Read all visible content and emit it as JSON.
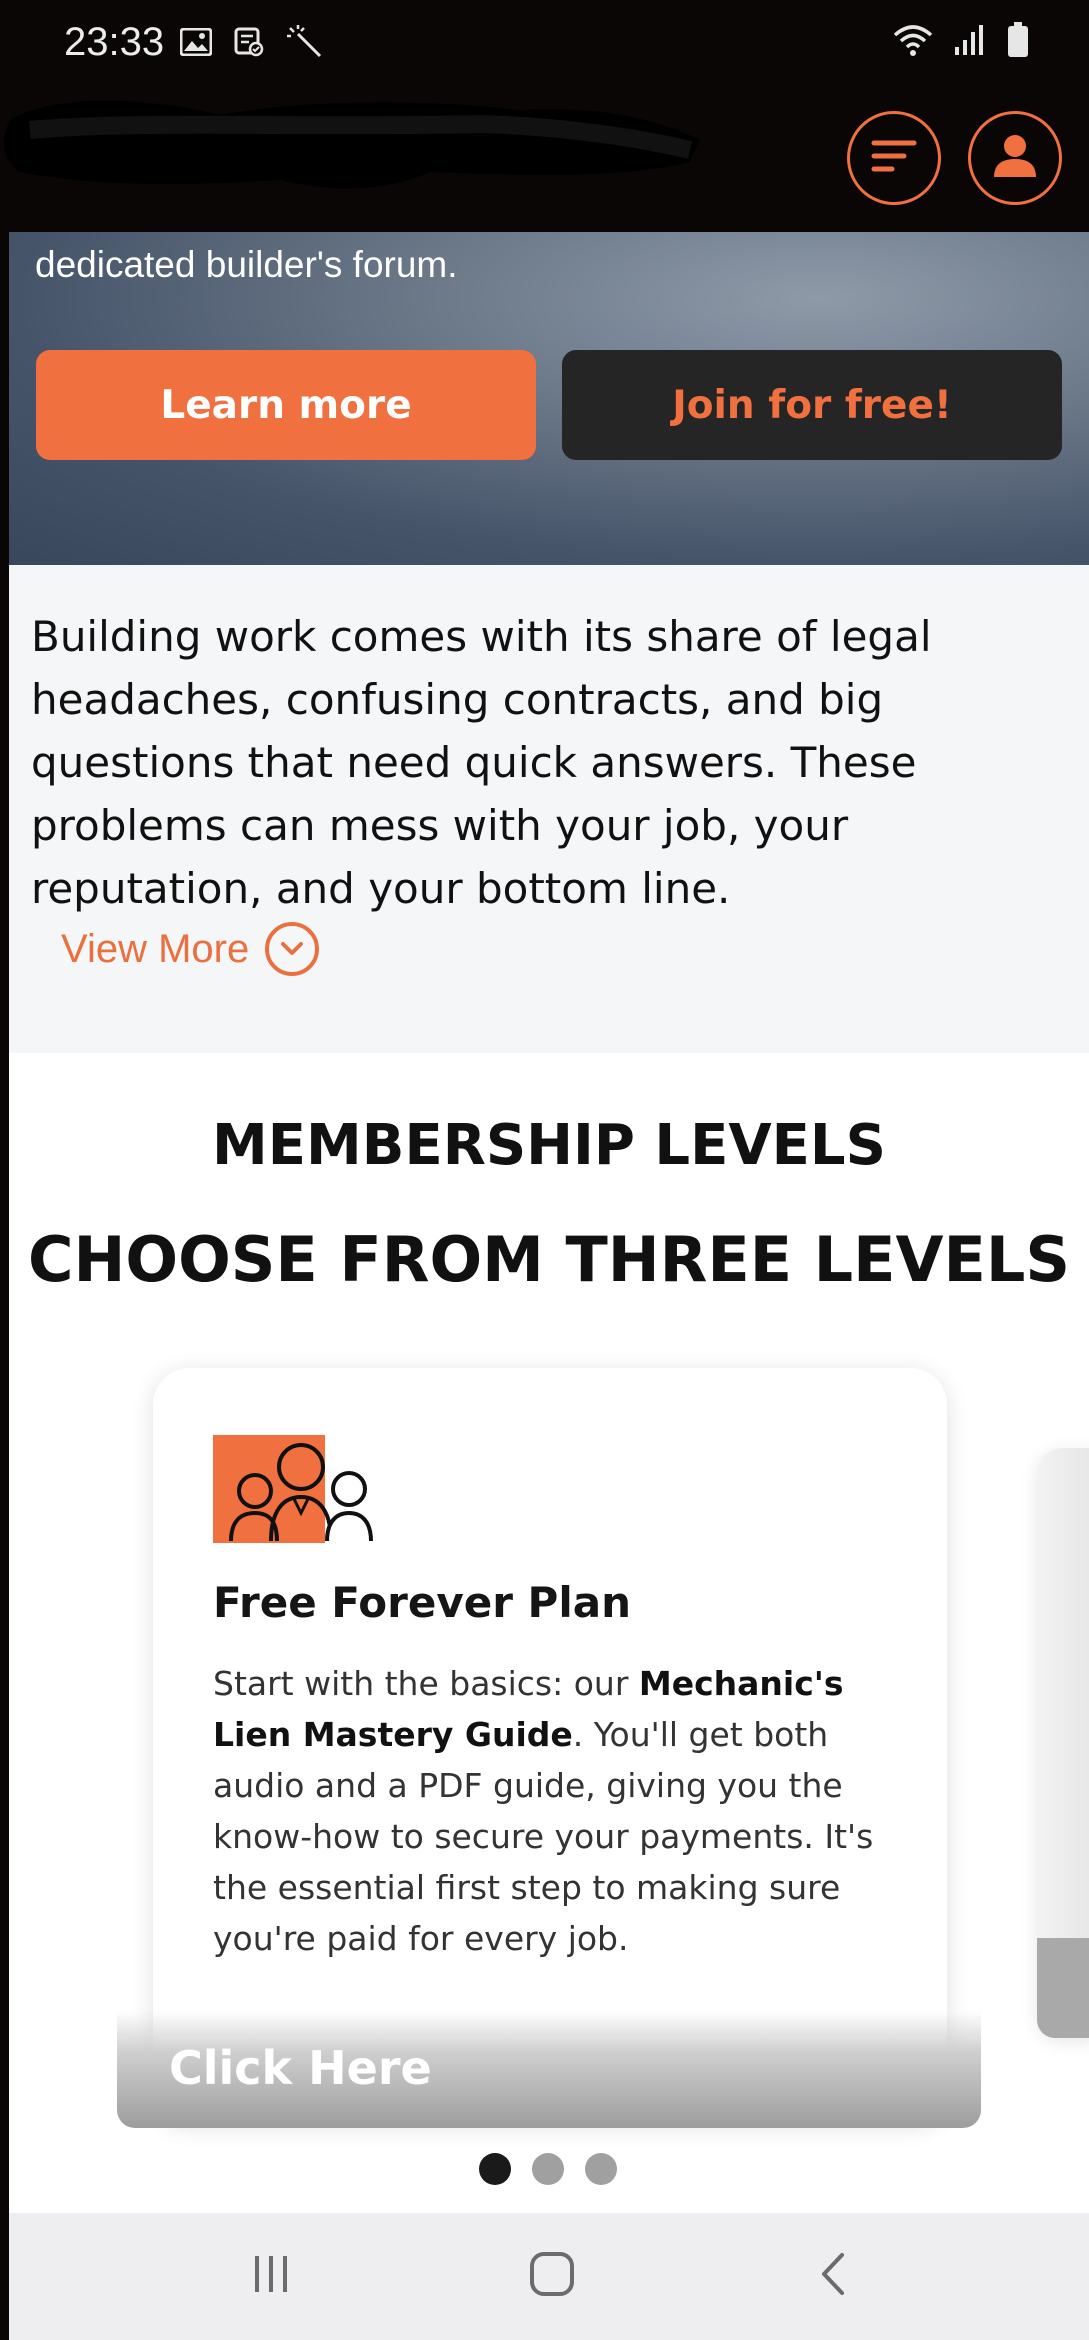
{
  "status_bar": {
    "time": "23:33",
    "icons_left": [
      "image-icon",
      "notes-icon",
      "magic-wand-icon"
    ],
    "icons_right": [
      "wifi-icon",
      "signal-icon",
      "battery-icon"
    ]
  },
  "header": {
    "logo": "redacted",
    "buttons": [
      "menu-icon",
      "user-icon"
    ]
  },
  "hero": {
    "text": "dedicated builder's forum.",
    "learn_more": "Learn more",
    "join_free": "Join for free!"
  },
  "intro": {
    "paragraph": "Building work comes with its share of legal headaches, confusing contracts, and big questions that need quick answers. These problems can mess with your job, your reputation, and your bottom line.",
    "view_more": "View More"
  },
  "membership": {
    "subtitle": "MEMBERSHIP LEVELS",
    "title": "CHOOSE FROM THREE LEVELS",
    "card": {
      "icon": "team-people-icon",
      "title": "Free Forever Plan",
      "desc_before": "Start with the basics: our ",
      "desc_bold": "Mechanic's Lien Mastery Guide",
      "desc_after": ". You'll get both audio and a PDF guide, giving you the know-how to secure your payments. It's the essential first step to making sure you're paid for every job.",
      "cta": "Click Here"
    },
    "carousel_position": 1,
    "carousel_total": 3
  },
  "nav_bar": {
    "buttons": [
      "recents-icon",
      "home-icon",
      "back-icon"
    ]
  },
  "colors": {
    "accent": "#f07040",
    "header_bg": "#0b0606",
    "dark_button": "#252525",
    "intro_bg": "#f5f6f8"
  }
}
